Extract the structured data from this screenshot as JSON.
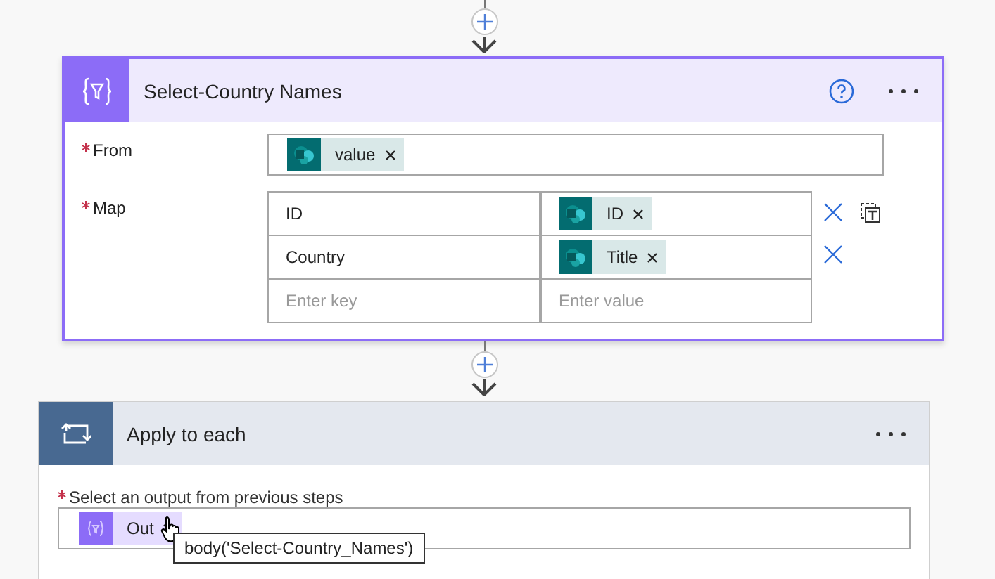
{
  "select_card": {
    "title": "Select-Country Names",
    "from": {
      "label": "From",
      "required": true,
      "tokens": [
        {
          "label": "value"
        }
      ]
    },
    "map": {
      "label": "Map",
      "required": true,
      "rows": [
        {
          "key": "ID",
          "value_token": "ID",
          "deletable": true,
          "text_mode": true
        },
        {
          "key": "Country",
          "value_token": "Title",
          "deletable": true,
          "text_mode": false
        }
      ],
      "key_placeholder": "Enter key",
      "value_placeholder": "Enter value"
    }
  },
  "apply_card": {
    "title": "Apply to each",
    "field": {
      "label": "Select an output from previous steps",
      "required": true,
      "tokens": [
        {
          "label": "Out"
        }
      ]
    },
    "tooltip": "body('Select-Country_Names')"
  }
}
